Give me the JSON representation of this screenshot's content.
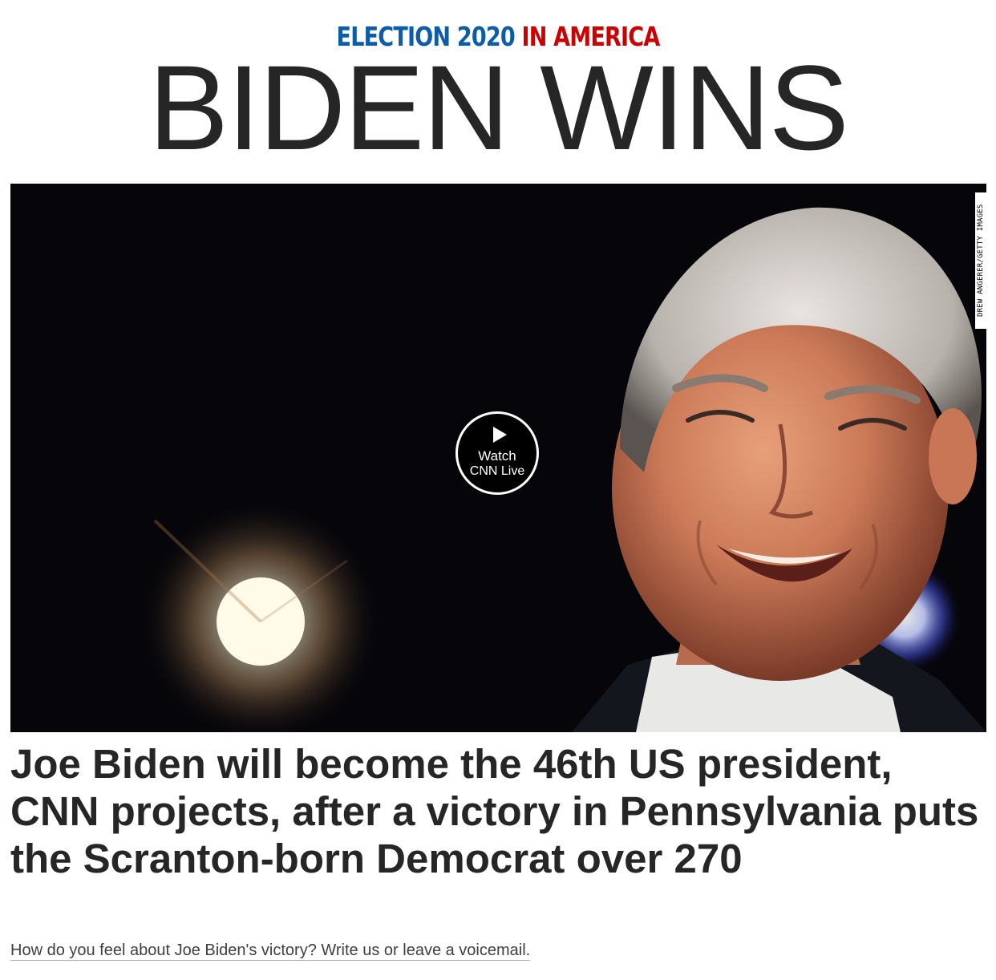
{
  "kicker": {
    "part1": "ELECTION 2020",
    "part2": "IN AMERICA",
    "color_blue": "#0c5da8",
    "color_red": "#cc0000"
  },
  "banner": {
    "title": "BIDEN WINS"
  },
  "hero": {
    "photo_credit": "DREW ANGERER/GETTY IMAGES",
    "watch_button": {
      "icon": "play-icon",
      "line1": "Watch",
      "line2": "CNN Live"
    }
  },
  "story": {
    "headline": "Joe Biden will become the 46th US president, CNN projects, after a victory in Pennsylvania puts the Scranton-born Democrat over 270",
    "feedback_link": "How do you feel about Joe Biden's victory? Write us or leave a voicemail."
  }
}
